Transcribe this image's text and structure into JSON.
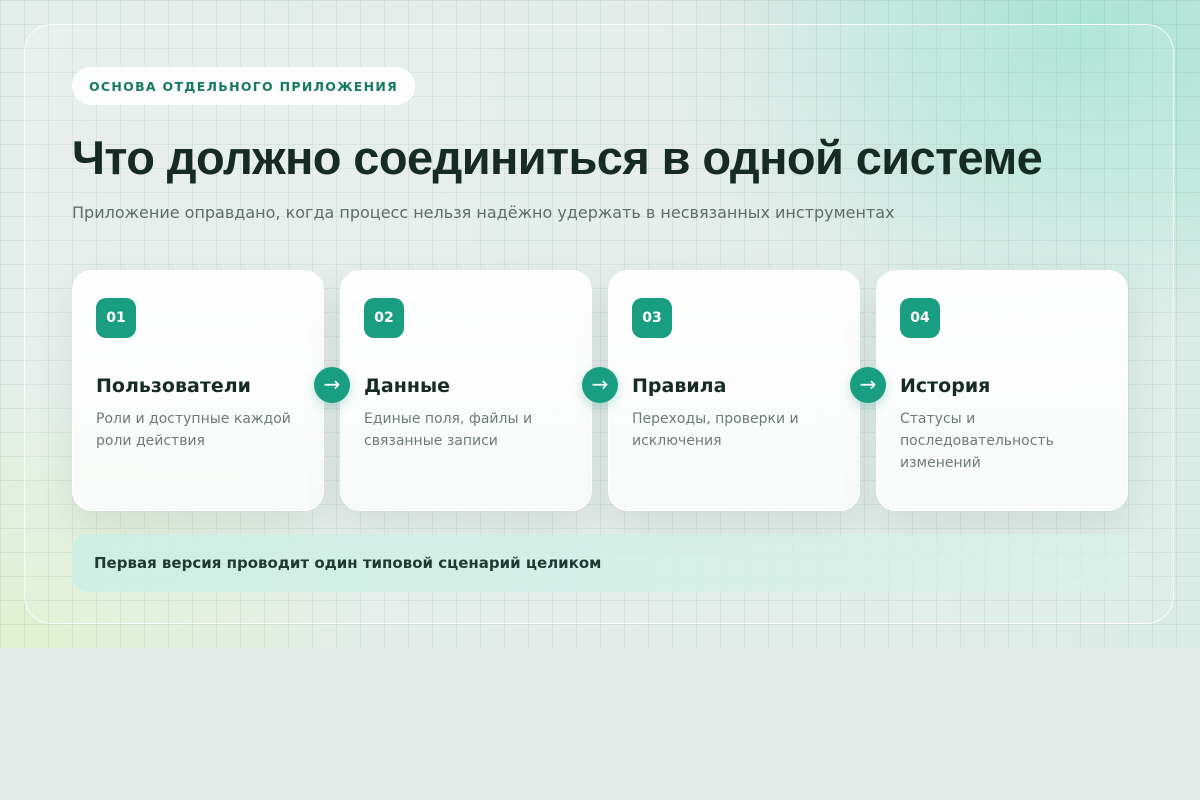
{
  "badge": "ОСНОВА ОТДЕЛЬНОГО ПРИЛОЖЕНИЯ",
  "title": "Что должно соединиться в одной системе",
  "subtitle": "Приложение оправдано, когда процесс нельзя надёжно удержать в несвязанных инструментах",
  "cards": [
    {
      "number": "01",
      "title": "Пользователи",
      "description": "Роли и доступные каждой роли действия"
    },
    {
      "number": "02",
      "title": "Данные",
      "description": "Единые поля, файлы и связанные записи"
    },
    {
      "number": "03",
      "title": "Правила",
      "description": "Переходы, проверки и исключения"
    },
    {
      "number": "04",
      "title": "История",
      "description": "Статусы и последовательность изменений"
    }
  ],
  "arrow_glyph": "→",
  "note": "Первая версия проводит один типовой сценарий целиком",
  "colors": {
    "accent": "#1a9e82",
    "badge_text": "#157a63",
    "title_text": "#152b24",
    "muted_text": "#6e7a76",
    "note_background": "#d4efe6"
  },
  "icons": {
    "connector": "arrow-right-icon"
  }
}
